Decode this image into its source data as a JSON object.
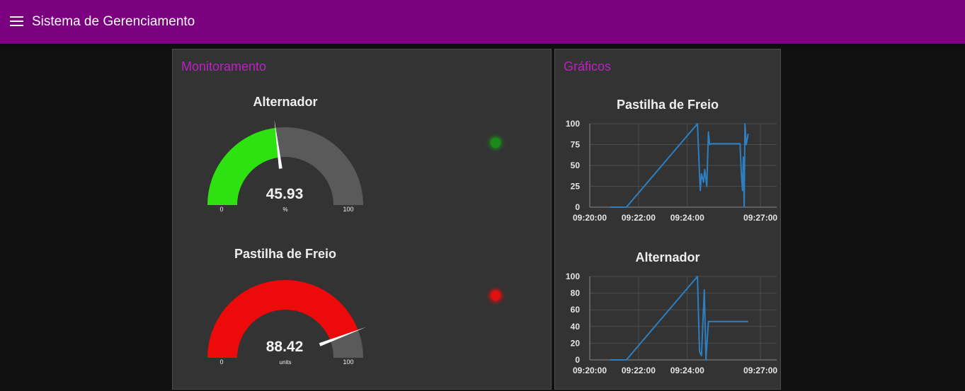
{
  "app": {
    "title": "Sistema de Gerenciamento"
  },
  "colors": {
    "toolbar": "#7a0080",
    "group_title": "#bd20c4",
    "ok": "#1a8a1a",
    "alarm": "#e01010",
    "line": "#2d7fc1"
  },
  "monitor": {
    "title": "Monitoramento",
    "gauges": [
      {
        "label": "Alternador",
        "value": 45.93,
        "value_text": "45.93",
        "units": "%",
        "min": 0,
        "max": 100,
        "min_label": "0",
        "max_label": "100",
        "fill": "#2ee110"
      },
      {
        "label": "Pastilha de Freio",
        "value": 88.42,
        "value_text": "88.42",
        "units": "units",
        "min": 0,
        "max": 100,
        "min_label": "0",
        "max_label": "100",
        "fill": "#ec0a0a"
      }
    ],
    "leds": [
      {
        "state": "ok",
        "color": "#1a8a1a"
      },
      {
        "state": "alarm",
        "color": "#e01010"
      }
    ]
  },
  "graphs": {
    "title": "Gráficos",
    "charts": [
      {
        "title": "Pastilha de Freio"
      },
      {
        "title": "Alternador"
      }
    ]
  },
  "chart_data": [
    {
      "type": "line",
      "title": "Pastilha de Freio",
      "xlim": [
        "09:20:00",
        "09:27:40"
      ],
      "ylim": [
        0,
        100
      ],
      "yticks": [
        "100",
        "75",
        "50",
        "25",
        "0"
      ],
      "xticks": [
        "09:20:00",
        "09:22:00",
        "09:24:00",
        "09:27:00"
      ],
      "series": [
        {
          "x": [
            "09:20:50",
            "09:21:30",
            "09:24:25",
            "09:24:30",
            "09:24:32",
            "09:24:35",
            "09:24:40",
            "09:24:43",
            "09:24:48",
            "09:24:52",
            "09:24:55",
            "09:25:00",
            "09:25:50",
            "09:26:10",
            "09:26:13",
            "09:26:16",
            "09:26:18",
            "09:26:20",
            "09:26:22",
            "09:26:25",
            "09:26:30"
          ],
          "y": [
            0,
            0,
            100,
            40,
            20,
            40,
            30,
            45,
            25,
            90,
            75,
            76,
            76,
            76,
            40,
            20,
            60,
            0,
            100,
            75,
            88
          ]
        }
      ]
    },
    {
      "type": "line",
      "title": "Alternador",
      "xlim": [
        "09:20:00",
        "09:27:40"
      ],
      "ylim": [
        0,
        100
      ],
      "yticks": [
        "100",
        "80",
        "60",
        "40",
        "20",
        "0"
      ],
      "xticks": [
        "09:20:00",
        "09:22:00",
        "09:24:00",
        "09:27:00"
      ],
      "series": [
        {
          "x": [
            "09:20:50",
            "09:21:30",
            "09:24:25",
            "09:24:30",
            "09:24:35",
            "09:24:42",
            "09:24:46",
            "09:24:52",
            "09:26:30"
          ],
          "y": [
            0,
            0,
            100,
            10,
            5,
            84,
            0,
            46,
            46
          ]
        }
      ]
    }
  ]
}
